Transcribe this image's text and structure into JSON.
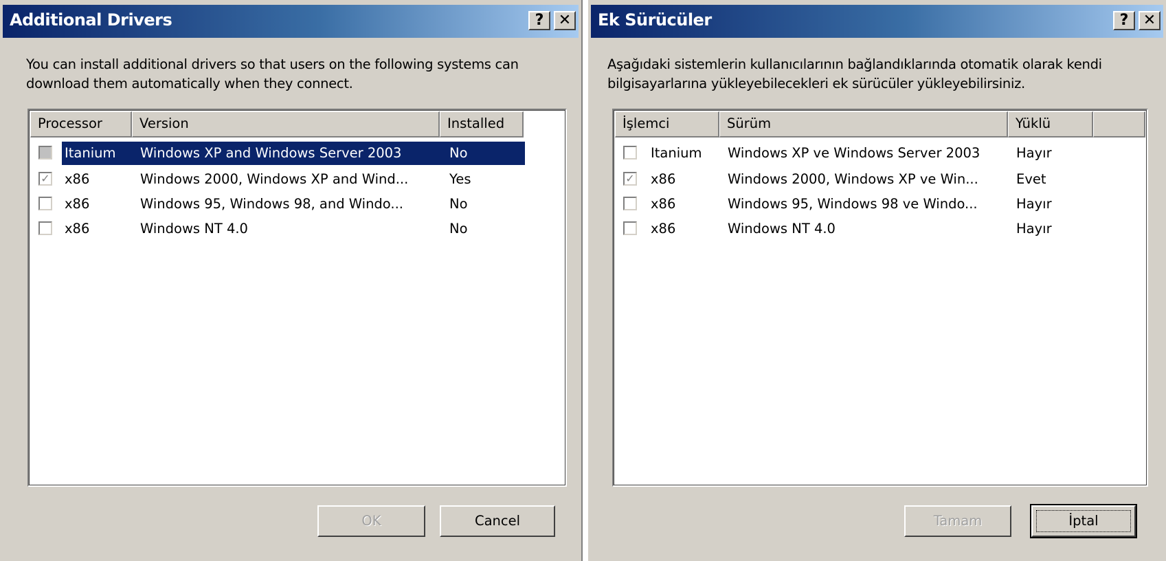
{
  "left": {
    "title": "Additional Drivers",
    "help_glyph": "?",
    "close_glyph": "✕",
    "description": "You can install additional drivers so that users on the following systems can download them automatically when they connect.",
    "columns": [
      "Processor",
      "Version",
      "Installed"
    ],
    "rows": [
      {
        "processor": "Itanium",
        "version": "Windows XP and Windows Server 2003",
        "installed": "No",
        "checked": false,
        "selected": true
      },
      {
        "processor": "x86",
        "version": "Windows 2000, Windows XP and Wind...",
        "installed": "Yes",
        "checked": true,
        "selected": false
      },
      {
        "processor": "x86",
        "version": "Windows 95, Windows 98, and Windo...",
        "installed": "No",
        "checked": false,
        "selected": false
      },
      {
        "processor": "x86",
        "version": "Windows NT 4.0",
        "installed": "No",
        "checked": false,
        "selected": false
      }
    ],
    "ok_label": "OK",
    "cancel_label": "Cancel"
  },
  "right": {
    "title": "Ek Sürücüler",
    "help_glyph": "?",
    "close_glyph": "✕",
    "description": "Aşağıdaki sistemlerin kullanıcılarının bağlandıklarında otomatik olarak kendi bilgisayarlarına yükleyebilecekleri ek sürücüler yükleyebilirsiniz.",
    "columns": [
      "İşlemci",
      "Sürüm",
      "Yüklü"
    ],
    "rows": [
      {
        "processor": "Itanium",
        "version": "Windows XP ve Windows Server 2003",
        "installed": "Hayır",
        "checked": false,
        "selected": false
      },
      {
        "processor": "x86",
        "version": "Windows 2000, Windows XP ve Win...",
        "installed": "Evet",
        "checked": true,
        "selected": false
      },
      {
        "processor": "x86",
        "version": "Windows 95, Windows 98 ve Windo...",
        "installed": "Hayır",
        "checked": false,
        "selected": false
      },
      {
        "processor": "x86",
        "version": "Windows NT 4.0",
        "installed": "Hayır",
        "checked": false,
        "selected": false
      }
    ],
    "ok_label": "Tamam",
    "cancel_label": "İptal"
  },
  "check_glyph": "✓"
}
